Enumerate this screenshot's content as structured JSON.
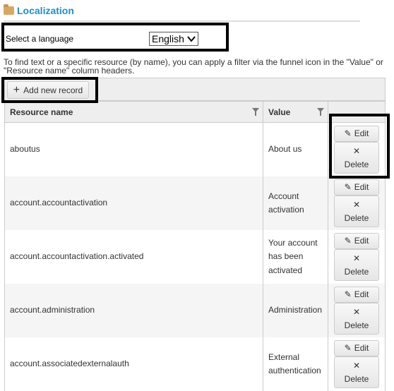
{
  "header": {
    "title": "Localization",
    "icon": "folder-icon"
  },
  "language": {
    "label": "Select a language",
    "selected": "English"
  },
  "help_text": "To find text or a specific resource (by name), you can apply a filter via the funnel icon in the \"Value\" or \"Resource name\" column headers.",
  "toolbar": {
    "add_label": "Add new record"
  },
  "table": {
    "columns": [
      "Resource name",
      "Value",
      ""
    ],
    "edit_label": "Edit",
    "delete_label": "Delete",
    "rows": [
      {
        "name": "aboutus",
        "value": "About us"
      },
      {
        "name": "account.accountactivation",
        "value": "Account activation"
      },
      {
        "name": "account.accountactivation.activated",
        "value": "Your account has been activated"
      },
      {
        "name": "account.administration",
        "value": "Administration"
      },
      {
        "name": "account.associatedexternalauth",
        "value": "External authentication"
      }
    ]
  }
}
